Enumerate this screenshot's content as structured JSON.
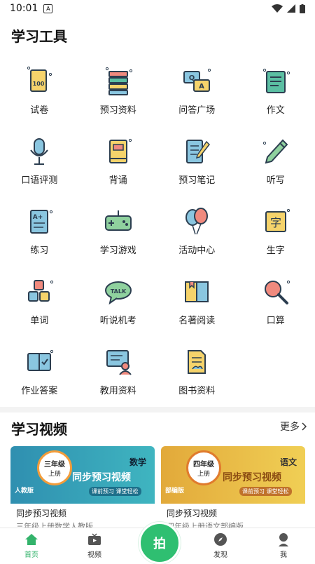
{
  "status": {
    "time": "10:01",
    "sim_label": "A"
  },
  "tools_section": {
    "title": "学习工具",
    "items": [
      {
        "label": "试卷",
        "icon": "exam-paper-icon"
      },
      {
        "label": "预习资料",
        "icon": "books-stack-icon"
      },
      {
        "label": "问答广场",
        "icon": "qa-chat-icon"
      },
      {
        "label": "作文",
        "icon": "essay-book-icon"
      },
      {
        "label": "口语评测",
        "icon": "microphone-icon"
      },
      {
        "label": "背诵",
        "icon": "recite-book-icon"
      },
      {
        "label": "预习笔记",
        "icon": "notebook-pen-icon"
      },
      {
        "label": "听写",
        "icon": "dictation-pen-icon"
      },
      {
        "label": "练习",
        "icon": "practice-sheet-icon"
      },
      {
        "label": "学习游戏",
        "icon": "gamepad-icon"
      },
      {
        "label": "活动中心",
        "icon": "balloons-icon"
      },
      {
        "label": "生字",
        "icon": "character-card-icon"
      },
      {
        "label": "单词",
        "icon": "word-blocks-icon"
      },
      {
        "label": "听说机考",
        "icon": "talk-bubble-icon"
      },
      {
        "label": "名著阅读",
        "icon": "open-book-icon"
      },
      {
        "label": "口算",
        "icon": "magnifier-icon"
      },
      {
        "label": "作业答案",
        "icon": "homework-answer-icon"
      },
      {
        "label": "教用资料",
        "icon": "teacher-board-icon"
      },
      {
        "label": "图书资料",
        "icon": "document-icon"
      }
    ]
  },
  "video_section": {
    "title": "学习视频",
    "more": "更多",
    "cards": [
      {
        "grade": "三年级",
        "volume": "上册",
        "subject": "数学",
        "edition": "人教版",
        "banner": "同步预习视频",
        "tagline": "课前预习 课堂轻松",
        "title": "同步预习视频",
        "subtitle": "三年级上册数学人教版",
        "color": "#39a5b9"
      },
      {
        "grade": "四年级",
        "volume": "上册",
        "subject": "语文",
        "edition": "部编版",
        "banner": "同步预习视频",
        "tagline": "课前预习 课堂轻松",
        "title": "同步预习视频",
        "subtitle": "四年级上册语文部编版",
        "color": "#e2b53b"
      }
    ]
  },
  "nav": {
    "items": [
      {
        "label": "首页"
      },
      {
        "label": "视频"
      },
      {
        "label": "发现"
      },
      {
        "label": "我"
      }
    ],
    "camera_label": "拍"
  },
  "colors": {
    "accent": "#2fbf71",
    "icon_yellow": "#f5d36b",
    "icon_teal": "#3aa5a5",
    "icon_outline": "#2c3e50"
  }
}
